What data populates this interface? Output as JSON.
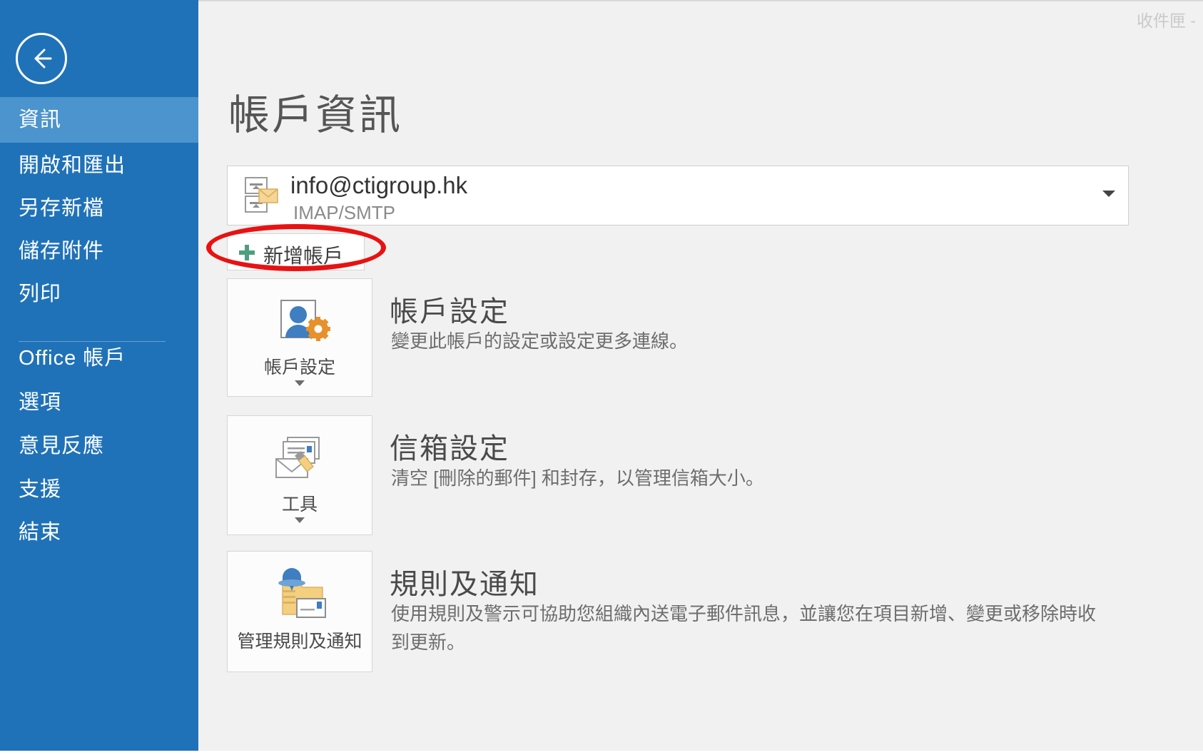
{
  "window": {
    "top_right_label": "收件匣 -"
  },
  "sidebar": {
    "back_icon": "back-arrow-icon",
    "items": [
      {
        "label": "資訊",
        "active": true
      },
      {
        "label": "開啟和匯出",
        "active": false
      },
      {
        "label": "另存新檔",
        "active": false
      },
      {
        "label": "儲存附件",
        "active": false
      },
      {
        "label": "列印",
        "active": false
      },
      {
        "label": "Office 帳戶",
        "active": false
      },
      {
        "label": "選項",
        "active": false
      },
      {
        "label": "意見反應",
        "active": false
      },
      {
        "label": "支援",
        "active": false
      },
      {
        "label": "結束",
        "active": false
      }
    ]
  },
  "main": {
    "page_title": "帳戶資訊",
    "account_selector": {
      "email": "info@ctigroup.hk",
      "protocol": "IMAP/SMTP",
      "icon": "mail-account-icon",
      "chevron": "chevron-down-icon"
    },
    "add_account_button": {
      "label": "新增帳戶",
      "icon": "plus-icon",
      "annotation_color": "#e81212"
    },
    "sections": [
      {
        "tile_label": "帳戶設定",
        "tile_icon": "account-settings-icon",
        "has_caret": true,
        "title": "帳戶設定",
        "description": "變更此帳戶的設定或設定更多連線。"
      },
      {
        "tile_label": "工具",
        "tile_icon": "mailbox-cleanup-tools-icon",
        "has_caret": true,
        "title": "信箱設定",
        "description": "清空 [刪除的郵件] 和封存，以管理信箱大小。"
      },
      {
        "tile_label": "管理規則及通知",
        "tile_icon": "rules-alerts-icon",
        "has_caret": false,
        "title": "規則及通知",
        "description": "使用規則及警示可協助您組織內送電子郵件訊息，並讓您在項目新增、變更或移除時收到更新。"
      }
    ]
  },
  "colors": {
    "sidebar_blue": "#2072b8",
    "sidebar_active": "#4b94cd",
    "content_bg": "#f1f1f1",
    "annotation_red": "#e81212",
    "accent_green": "#4e9e7f",
    "accent_orange": "#e8902a",
    "accent_blue": "#3f7ec0",
    "accent_yellow": "#f3cf7f"
  }
}
